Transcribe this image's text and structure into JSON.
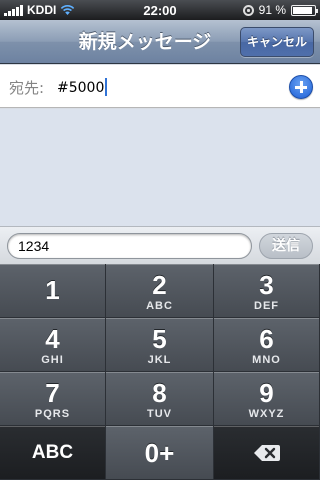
{
  "status_bar": {
    "carrier": "KDDI",
    "time": "22:00",
    "battery": "91 %",
    "battery_level": 0.91,
    "signal_bars": 5,
    "icons": [
      "signal-icon",
      "wifi-icon",
      "rotation-lock-icon",
      "battery-icon"
    ]
  },
  "nav": {
    "title": "新規メッセージ",
    "cancel_label": "キャンセル"
  },
  "to_field": {
    "label": "宛先:",
    "value": "#5000",
    "add_icon": "add-contact-icon"
  },
  "compose": {
    "text": "1234",
    "send_label": "送信"
  },
  "keypad": {
    "keys": [
      {
        "digit": "1",
        "letters": ""
      },
      {
        "digit": "2",
        "letters": "ABC"
      },
      {
        "digit": "3",
        "letters": "DEF"
      },
      {
        "digit": "4",
        "letters": "GHI"
      },
      {
        "digit": "5",
        "letters": "JKL"
      },
      {
        "digit": "6",
        "letters": "MNO"
      },
      {
        "digit": "7",
        "letters": "PQRS"
      },
      {
        "digit": "8",
        "letters": "TUV"
      },
      {
        "digit": "9",
        "letters": "WXYZ"
      }
    ],
    "abc_label": "ABC",
    "zero_label": "0+",
    "delete_icon": "backspace-icon"
  },
  "colors": {
    "nav_accent": "#6d82a1",
    "button_blue": "#4f6fab",
    "key_gray": "#464b52",
    "caret": "#3173d6"
  }
}
